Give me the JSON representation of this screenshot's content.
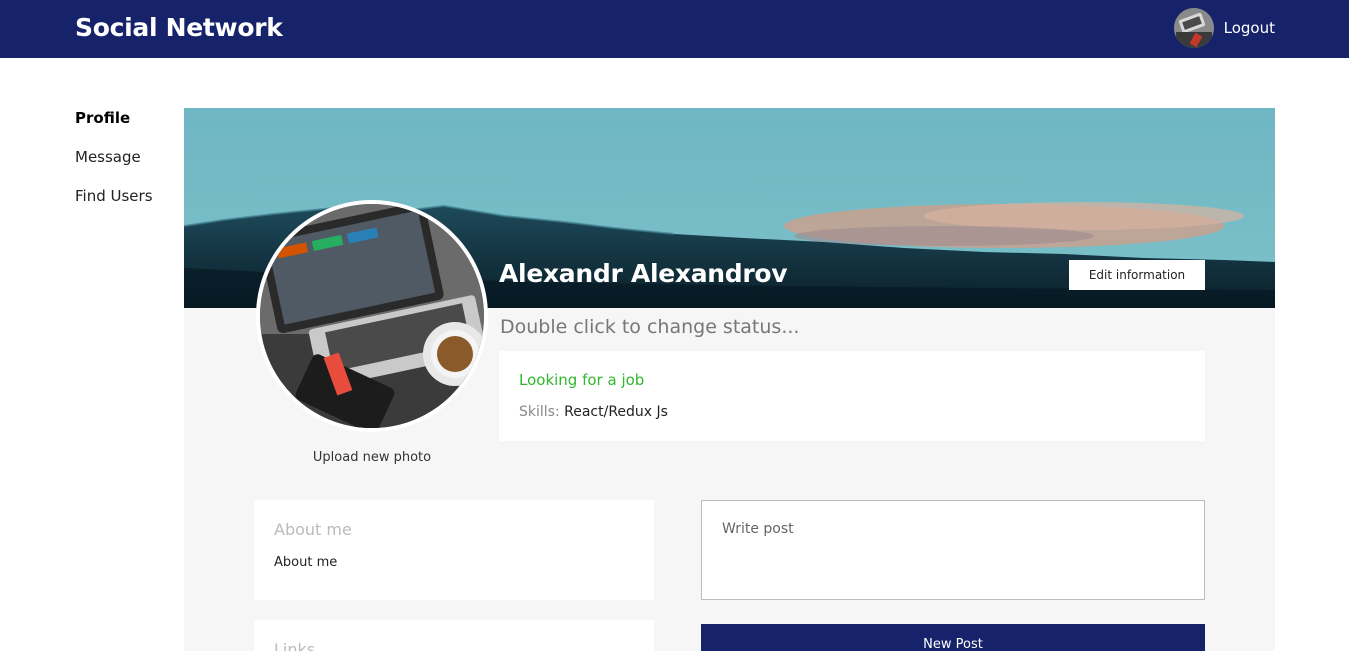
{
  "header": {
    "brand": "Social Network",
    "logout_label": "Logout"
  },
  "sidebar": {
    "items": [
      {
        "label": "Profile",
        "active": true
      },
      {
        "label": "Message",
        "active": false
      },
      {
        "label": "Find Users",
        "active": false
      }
    ]
  },
  "profile": {
    "name": "Alexandr Alexandrov",
    "edit_label": "Edit information",
    "status_text": "Double click to change status...",
    "upload_label": "Upload new photo",
    "job_status": "Looking for a job",
    "skills_label": "Skills:",
    "skills_value": "React/Redux Js"
  },
  "about": {
    "title": "About me",
    "text": "About me"
  },
  "links": {
    "title": "Links"
  },
  "post": {
    "placeholder": "Write post",
    "button_label": "New Post"
  },
  "colors": {
    "header_bg": "#16236b",
    "job_status": "#32b72e",
    "content_bg": "#f6f6f6",
    "button_bg": "#16236b"
  },
  "icons": {
    "user_avatar": "user-avatar-photo",
    "cover": "mountain-landscape-image",
    "profile_photo": "laptop-desk-photo"
  }
}
